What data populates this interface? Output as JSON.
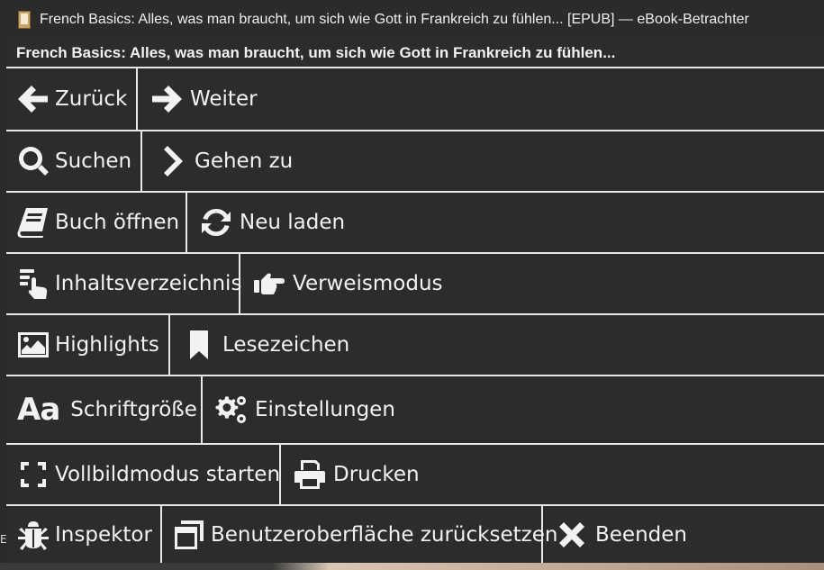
{
  "window": {
    "title": "French Basics: Alles, was man braucht, um sich wie Gott in Frankreich zu fühlen... [EPUB] — eBook-Betrachter"
  },
  "book": {
    "title": "French Basics: Alles, was man braucht, um sich wie Gott in Frankreich zu fühlen..."
  },
  "menu": {
    "back": "Zurück",
    "forward": "Weiter",
    "search": "Suchen",
    "goto": "Gehen zu",
    "open_book": "Buch öffnen",
    "reload": "Neu laden",
    "toc": "Inhaltsverzeichnis",
    "reference_mode": "Verweismodus",
    "highlights": "Highlights",
    "bookmarks": "Lesezeichen",
    "font_size_glyph": "Aa",
    "font_size": "Schriftgröße",
    "settings": "Einstellungen",
    "fullscreen": "Vollbildmodus starten",
    "print": "Drucken",
    "inspector": "Inspektor",
    "reset_ui": "Benutzeroberfläche zurücksetzen",
    "quit": "Beenden"
  },
  "colors": {
    "background": "#2c2c2c",
    "separator": "#e8e8e8",
    "text": "#f2f2f2",
    "titlebar": "#2b2b2b"
  }
}
